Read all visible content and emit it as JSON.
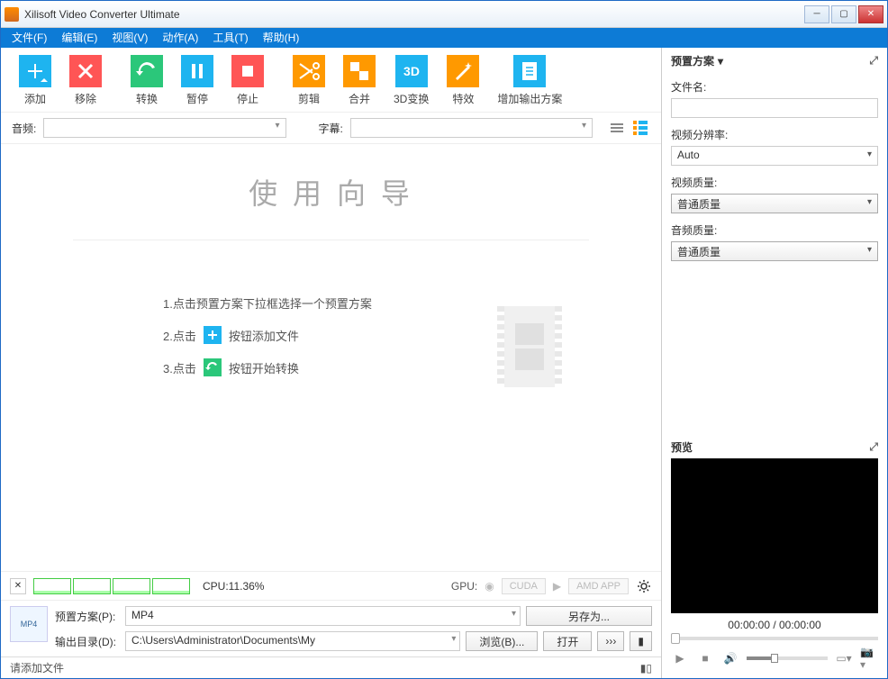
{
  "window": {
    "title": "Xilisoft Video Converter Ultimate"
  },
  "menu": {
    "file": "文件(F)",
    "edit": "编辑(E)",
    "view": "视图(V)",
    "action": "动作(A)",
    "tools": "工具(T)",
    "help": "帮助(H)"
  },
  "toolbar": {
    "add": "添加",
    "remove": "移除",
    "convert": "转换",
    "pause": "暂停",
    "stop": "停止",
    "cut": "剪辑",
    "merge": "合并",
    "threed": "3D变换",
    "effect": "特效",
    "addProfile": "增加输出方案"
  },
  "selectors": {
    "audio": "音频:",
    "subtitle": "字幕:"
  },
  "wizard": {
    "title": "使 用 向 导",
    "step1": "1.点击预置方案下拉框选择一个预置方案",
    "step2a": "2.点击",
    "step2b": "按钮添加文件",
    "step3a": "3.点击",
    "step3b": "按钮开始转换"
  },
  "status": {
    "cpu": "CPU:11.36%",
    "gpu": "GPU:",
    "cuda": "CUDA",
    "amd": "AMD APP"
  },
  "bottom": {
    "profileLabel": "预置方案(P):",
    "profileValue": "MP4",
    "saveAs": "另存为...",
    "outputLabel": "输出目录(D):",
    "outputValue": "C:\\Users\\Administrator\\Documents\\My",
    "browse": "浏览(B)...",
    "open": "打开",
    "more": "›››"
  },
  "statusbar": {
    "message": "请添加文件"
  },
  "rightPanel": {
    "header": "预置方案",
    "filenameLabel": "文件名:",
    "resolutionLabel": "视频分辨率:",
    "resolutionValue": "Auto",
    "videoQualityLabel": "视频质量:",
    "videoQualityValue": "普通质量",
    "audioQualityLabel": "音频质量:",
    "audioQualityValue": "普通质量"
  },
  "preview": {
    "header": "预览",
    "time": "00:00:00 / 00:00:00"
  },
  "colors": {
    "blue": "#1eb4f0",
    "red": "#f44",
    "green": "#2bc77a",
    "orange": "#f90"
  }
}
